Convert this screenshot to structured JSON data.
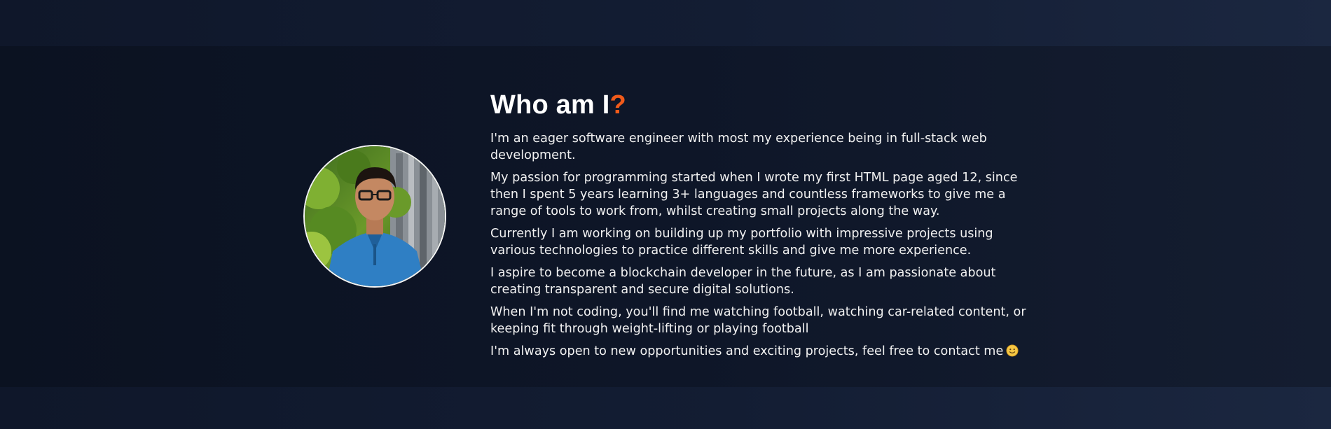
{
  "about": {
    "title": "Who am I",
    "title_accent": "?",
    "accent_color": "#f05a1a",
    "profile_image_alt": "profile photo",
    "paragraphs": [
      "I'm an eager software engineer with most my experience being in full-stack web development.",
      "My passion for programming started when I wrote my first HTML page aged 12, since then I spent 5 years learning 3+ languages and countless frameworks to give me a range of tools to work from, whilst creating small projects along the way.",
      "Currently I am working on building up my portfolio with impressive projects using various technologies to practice different skills and give me more experience.",
      "I aspire to become a blockchain developer in the future, as I am passionate about creating transparent and secure digital solutions.",
      "When I'm not coding, you'll find me watching football, watching car-related content, or keeping fit through weight-lifting or playing football",
      "I'm always open to new opportunities and exciting projects, feel free to contact me"
    ],
    "emoji_icon": "slightly-smiling-face-icon"
  }
}
